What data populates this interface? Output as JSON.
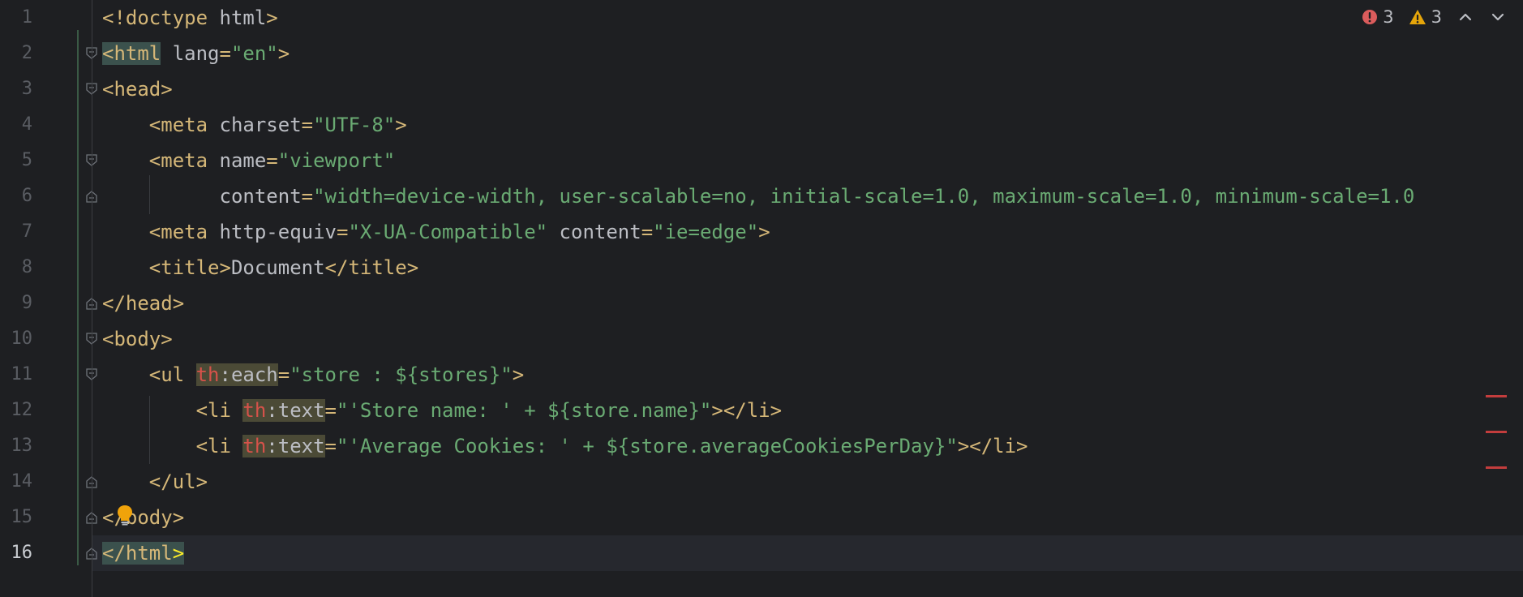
{
  "inspection": {
    "errors_count": "3",
    "warnings_count": "3",
    "colors": {
      "error": "#db5c5c",
      "warning": "#e5a50a"
    }
  },
  "editor": {
    "current_line": 16,
    "line_numbers": [
      "1",
      "2",
      "3",
      "4",
      "5",
      "6",
      "7",
      "8",
      "9",
      "10",
      "11",
      "12",
      "13",
      "14",
      "15",
      "16"
    ],
    "lines": [
      [
        {
          "t": "<!doctype ",
          "c": "t-tag"
        },
        {
          "t": "html",
          "c": "t-attr"
        },
        {
          "t": ">",
          "c": "t-tag"
        }
      ],
      [
        {
          "t": "<html",
          "c": "t-tag hl-tag"
        },
        {
          "t": " lang",
          "c": "t-attr"
        },
        {
          "t": "=",
          "c": "t-tag"
        },
        {
          "t": "\"en\"",
          "c": "t-str"
        },
        {
          "t": ">",
          "c": "t-tag"
        }
      ],
      [
        {
          "t": "<head>",
          "c": "t-tag"
        }
      ],
      [
        {
          "t": "    <meta",
          "c": "t-tag"
        },
        {
          "t": " charset",
          "c": "t-attr"
        },
        {
          "t": "=",
          "c": "t-tag"
        },
        {
          "t": "\"UTF-8\"",
          "c": "t-str"
        },
        {
          "t": ">",
          "c": "t-tag"
        }
      ],
      [
        {
          "t": "    <meta",
          "c": "t-tag"
        },
        {
          "t": " name",
          "c": "t-attr"
        },
        {
          "t": "=",
          "c": "t-tag"
        },
        {
          "t": "\"viewport\"",
          "c": "t-str"
        }
      ],
      [
        {
          "t": "          content",
          "c": "t-attr"
        },
        {
          "t": "=",
          "c": "t-tag"
        },
        {
          "t": "\"width=device-width, user-scalable=no, initial-scale=1.0, maximum-scale=1.0, minimum-scale=1.0",
          "c": "t-str"
        }
      ],
      [
        {
          "t": "    <meta",
          "c": "t-tag"
        },
        {
          "t": " http-equiv",
          "c": "t-attr"
        },
        {
          "t": "=",
          "c": "t-tag"
        },
        {
          "t": "\"X-UA-Compatible\"",
          "c": "t-str"
        },
        {
          "t": " content",
          "c": "t-attr"
        },
        {
          "t": "=",
          "c": "t-tag"
        },
        {
          "t": "\"ie=edge\"",
          "c": "t-str"
        },
        {
          "t": ">",
          "c": "t-tag"
        }
      ],
      [
        {
          "t": "    <title>",
          "c": "t-tag"
        },
        {
          "t": "Document",
          "c": "t-text"
        },
        {
          "t": "</title>",
          "c": "t-tag"
        }
      ],
      [
        {
          "t": "</head>",
          "c": "t-tag"
        }
      ],
      [
        {
          "t": "<body>",
          "c": "t-tag"
        }
      ],
      [
        {
          "t": "    <ul ",
          "c": "t-tag"
        },
        {
          "t": "th",
          "c": "t-ns hl-usage"
        },
        {
          "t": ":each",
          "c": "t-attr hl-usage"
        },
        {
          "t": "=",
          "c": "t-tag"
        },
        {
          "t": "\"store : ${stores}\"",
          "c": "t-str"
        },
        {
          "t": ">",
          "c": "t-tag"
        }
      ],
      [
        {
          "t": "        <li ",
          "c": "t-tag"
        },
        {
          "t": "th",
          "c": "t-ns hl-usage"
        },
        {
          "t": ":text",
          "c": "t-attr hl-usage"
        },
        {
          "t": "=",
          "c": "t-tag"
        },
        {
          "t": "\"'Store name: ' + ${store.name}\"",
          "c": "t-str"
        },
        {
          "t": "></li>",
          "c": "t-tag"
        }
      ],
      [
        {
          "t": "        <li ",
          "c": "t-tag"
        },
        {
          "t": "th",
          "c": "t-ns hl-usage"
        },
        {
          "t": ":text",
          "c": "t-attr hl-usage"
        },
        {
          "t": "=",
          "c": "t-tag"
        },
        {
          "t": "\"'Average Cookies: ' + ${store.averageCookiesPerDay}\"",
          "c": "t-str"
        },
        {
          "t": "></li>",
          "c": "t-tag"
        }
      ],
      [
        {
          "t": "    </ul>",
          "c": "t-tag"
        }
      ],
      [
        {
          "t": "</body>",
          "c": "t-tag"
        }
      ],
      [
        {
          "t": "</html",
          "c": "t-tag hl-tag"
        },
        {
          "t": ">",
          "c": "t-tag hl-tag hl-brace"
        }
      ]
    ]
  },
  "icons": {
    "error": "error-circle-icon",
    "warning": "warning-triangle-icon",
    "prev": "chevron-up-icon",
    "next": "chevron-down-icon",
    "bulb": "lightbulb-icon",
    "fold": "fold-marker-icon"
  }
}
